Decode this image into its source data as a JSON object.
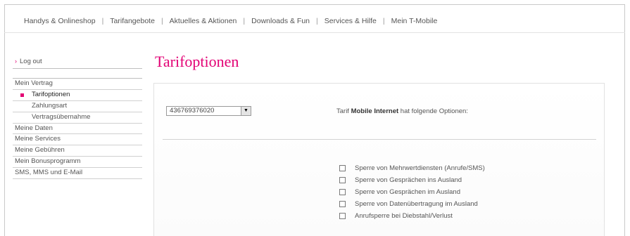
{
  "topnav": {
    "items": [
      {
        "label": "Handys & Onlineshop"
      },
      {
        "label": "Tarifangebote"
      },
      {
        "label": "Aktuelles & Aktionen"
      },
      {
        "label": "Downloads & Fun"
      },
      {
        "label": "Services & Hilfe"
      },
      {
        "label": "Mein T-Mobile"
      }
    ],
    "separator": "|"
  },
  "sidebar": {
    "logout": {
      "icon": "chevron-right-icon",
      "chevron": "›",
      "label": "Log out"
    },
    "items": [
      {
        "label": "Mein Vertrag"
      },
      {
        "label": "Tarifoptionen",
        "sub": true,
        "active": true
      },
      {
        "label": "Zahlungsart",
        "sub": true
      },
      {
        "label": "Vertragsübernahme",
        "sub": true
      },
      {
        "label": "Meine Daten"
      },
      {
        "label": "Meine Services"
      },
      {
        "label": "Meine Gebühren"
      },
      {
        "label": "Mein Bonusprogramm"
      },
      {
        "label": "SMS, MMS und E-Mail"
      }
    ],
    "accent_color": "#e20074"
  },
  "main": {
    "title": "Tarifoptionen",
    "number_select": {
      "value": "436769376020",
      "arrow": "▼"
    },
    "tarif": {
      "prefix": "Tarif",
      "name": "Mobile Internet",
      "suffix": "hat folgende Optionen:"
    },
    "options": [
      {
        "label": "Sperre von Mehrwertdiensten (Anrufe/SMS)",
        "checked": false
      },
      {
        "label": "Sperre von Gesprächen ins Ausland",
        "checked": false
      },
      {
        "label": "Sperre von Gesprächen im Ausland",
        "checked": false
      },
      {
        "label": "Sperre von Datenübertragung im Ausland",
        "checked": false
      },
      {
        "label": "Anrufsperre bei Diebstahl/Verlust",
        "checked": false
      }
    ]
  },
  "colors": {
    "brand": "#e20074"
  }
}
